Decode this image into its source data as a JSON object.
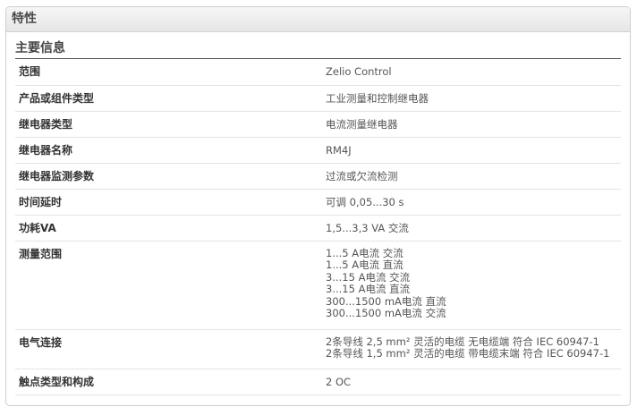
{
  "panel": {
    "title": "特性",
    "section_title": "主要信息"
  },
  "rows": [
    {
      "label": "范围",
      "values": [
        "Zelio Control"
      ]
    },
    {
      "label": "产品或组件类型",
      "values": [
        "工业测量和控制继电器"
      ]
    },
    {
      "label": "继电器类型",
      "values": [
        "电流测量继电器"
      ]
    },
    {
      "label": "继电器名称",
      "values": [
        "RM4J"
      ]
    },
    {
      "label": "继电器监测参数",
      "values": [
        "过流或欠流检测"
      ]
    },
    {
      "label": "时间延时",
      "values": [
        "可调 0,05...30 s"
      ]
    },
    {
      "label": "功耗VA",
      "values": [
        "1,5...3,3 VA 交流"
      ]
    },
    {
      "label": "测量范围",
      "values": [
        "1...5 A电流 交流",
        "1...5 A电流 直流",
        "3...15 A电流 交流",
        "3...15 A电流 直流",
        "300...1500 mA电流 直流",
        "300...1500 mA电流 交流"
      ]
    },
    {
      "label": "电气连接",
      "values": [
        "2条导线 2,5 mm² 灵活的电缆 无电缆端 符合 IEC 60947-1",
        "2条导线 1,5 mm² 灵活的电缆 带电缆末端 符合 IEC 60947-1"
      ]
    },
    {
      "label": "触点类型和构成",
      "values": [
        "2 OC"
      ]
    }
  ]
}
